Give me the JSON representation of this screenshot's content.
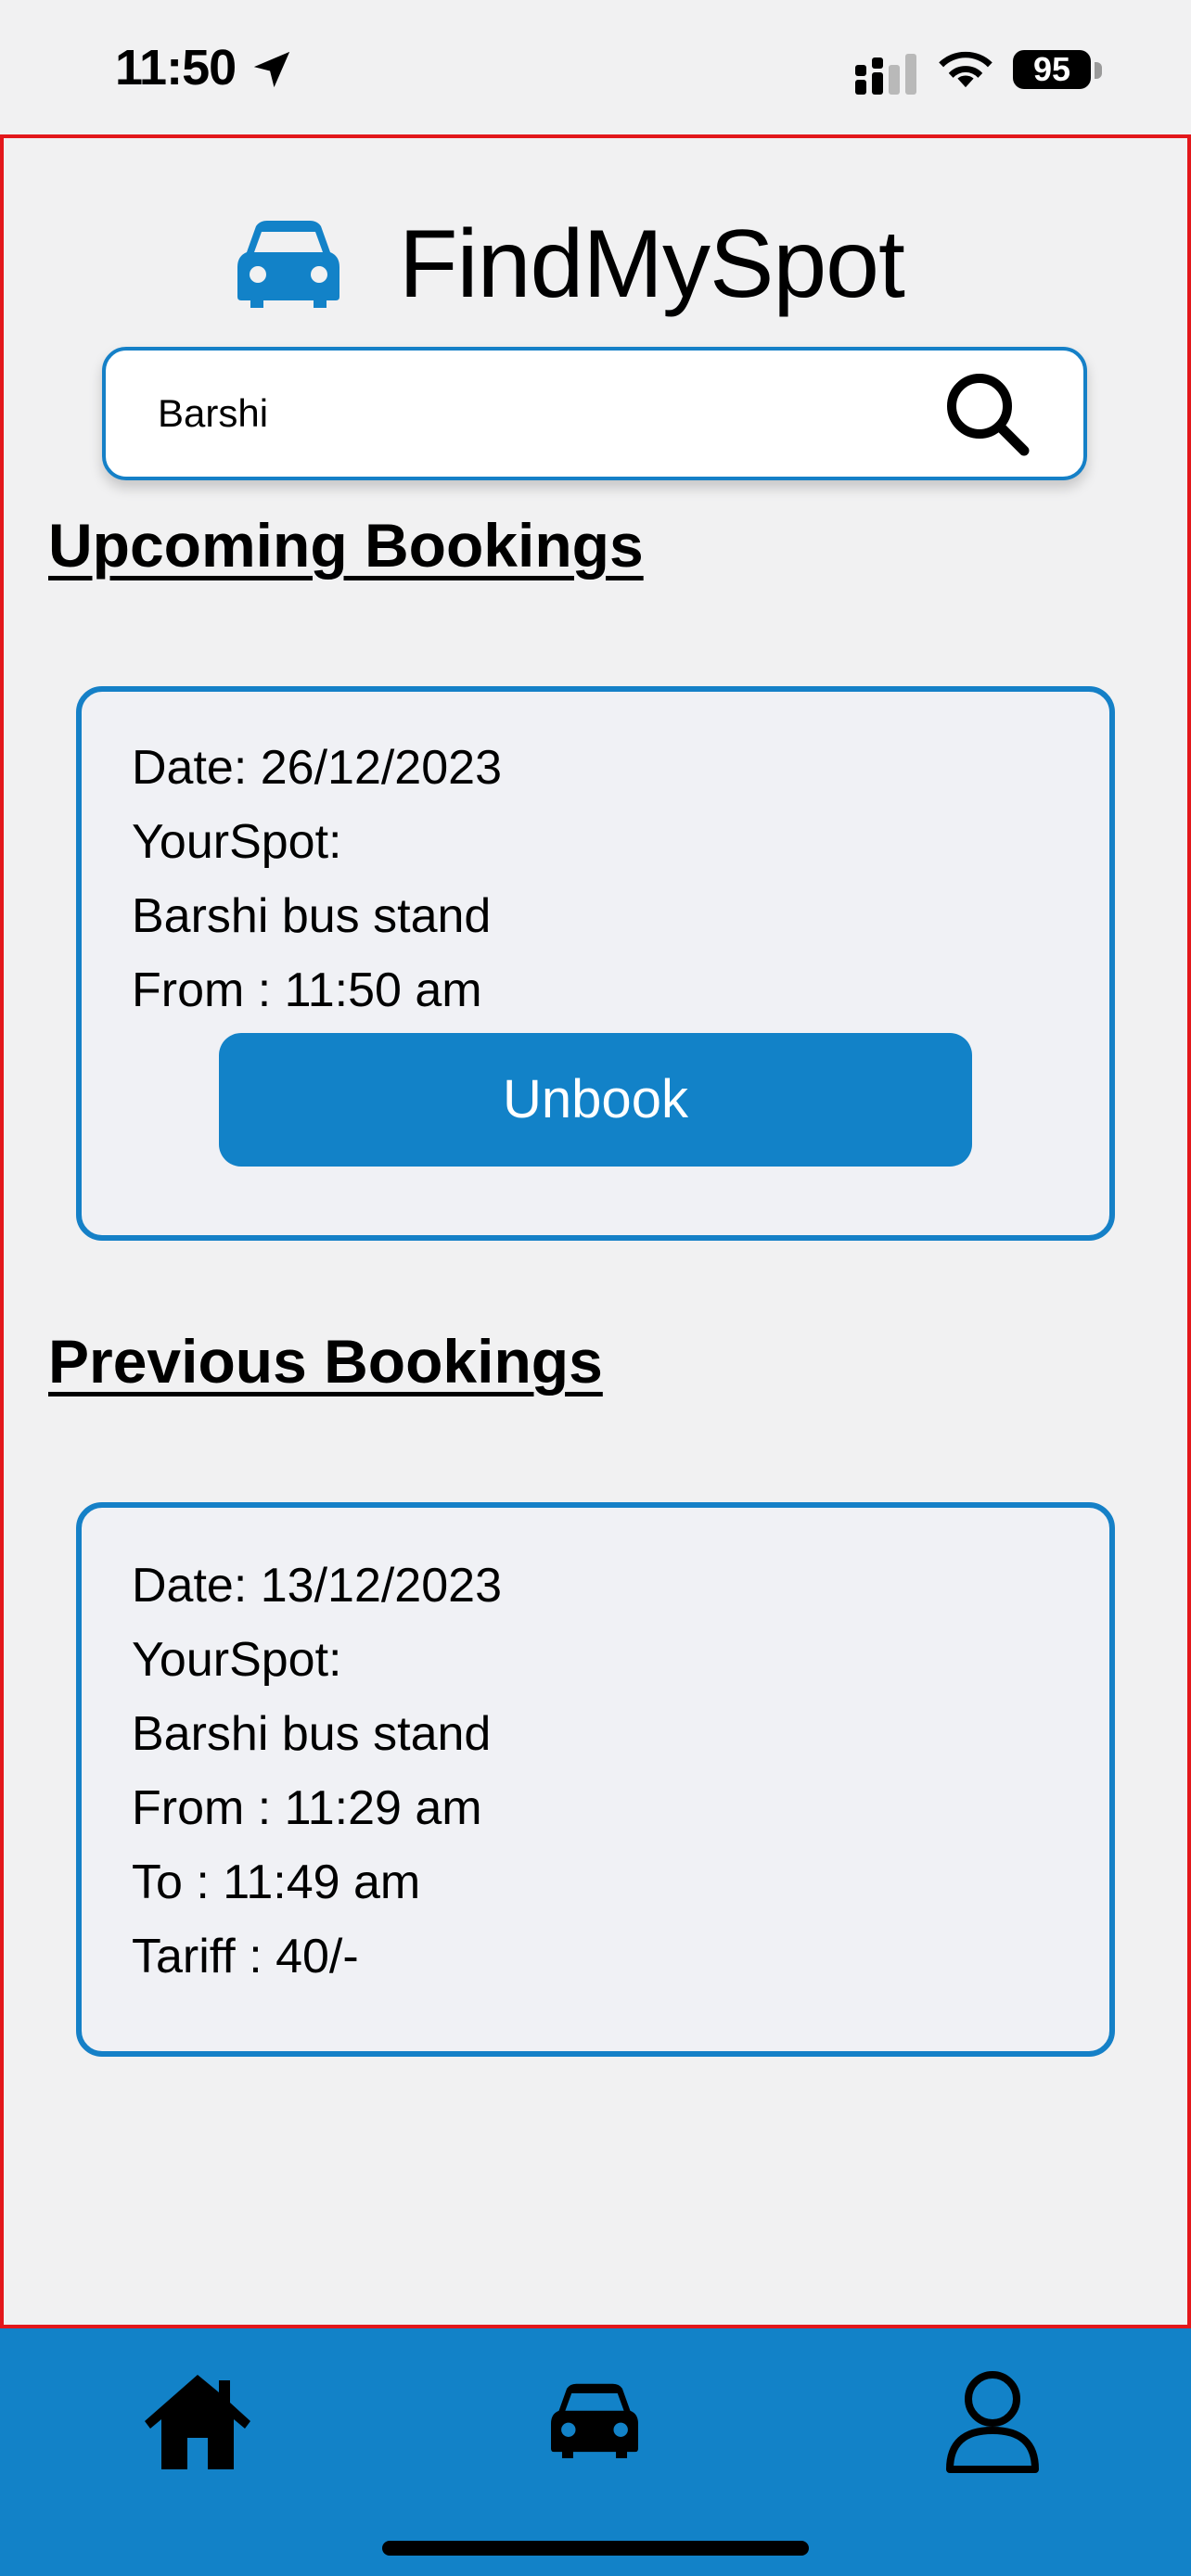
{
  "status_bar": {
    "time": "11:50",
    "battery": "95",
    "icons": [
      "location-arrow-icon",
      "signal-icon",
      "wifi-icon",
      "battery-icon"
    ]
  },
  "header": {
    "logo_icon": "car-icon",
    "title": "FindMySpot"
  },
  "search": {
    "value": "Barshi",
    "icon": "search-icon"
  },
  "upcoming": {
    "title": "Upcoming Bookings",
    "booking": {
      "date": "Date: 26/12/2023",
      "spot_label": "YourSpot:",
      "spot_name": "Barshi bus stand",
      "from": "From : 11:50 am",
      "button_label": "Unbook"
    }
  },
  "previous": {
    "title": "Previous Bookings",
    "booking": {
      "date": "Date: 13/12/2023",
      "spot_label": "YourSpot:",
      "spot_name": "Barshi bus stand",
      "from": "From : 11:29 am",
      "to": "To : 11:49 am",
      "tariff": "Tariff : 40/-"
    }
  },
  "bottom_nav": {
    "items": [
      "home-icon",
      "car-icon",
      "profile-icon"
    ]
  },
  "colors": {
    "accent": "#1282c8",
    "background": "#f1f1f2",
    "frame_border": "#e3171b"
  }
}
